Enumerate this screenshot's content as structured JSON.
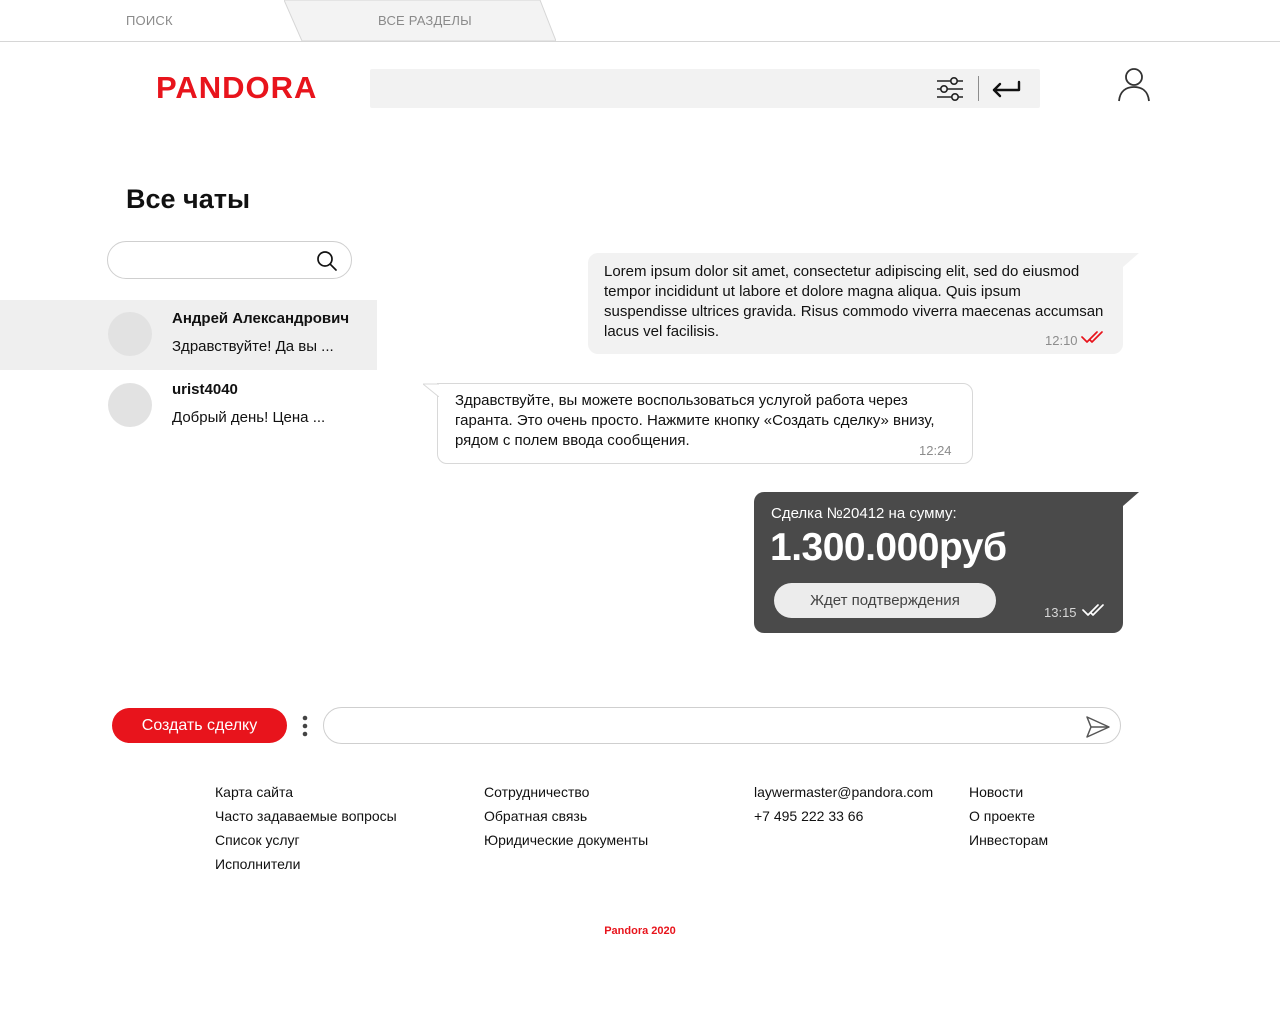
{
  "tabs": {
    "search": "ПОИСК",
    "all_sections": "ВСЕ РАЗДЕЛЫ"
  },
  "header": {
    "logo": "PANDORA",
    "search_value": ""
  },
  "sidebar": {
    "title": "Все чаты",
    "search_value": "",
    "chats": [
      {
        "name": "Андрей Александрович",
        "preview": "Здравствуйте! Да вы ...",
        "active": true
      },
      {
        "name": "urist4040",
        "preview": "Добрый день! Цена ...",
        "active": false
      }
    ]
  },
  "messages": {
    "out1": {
      "text": "Lorem ipsum dolor sit amet, consectetur adipiscing elit, sed do eiusmod tempor incididunt ut labore et dolore magna aliqua. Quis ipsum suspendisse ultrices gravida. Risus commodo viverra maecenas accumsan lacus vel facilisis.",
      "time": "12:10"
    },
    "in1": {
      "text": "Здравствуйте, вы можете воспользоваться услугой работа через гаранта. Это очень просто. Нажмите кнопку «Создать сделку» внизу, рядом с полем ввода сообщения.",
      "time": "12:24"
    },
    "deal": {
      "caption": "Сделка №20412 на сумму:",
      "amount": "1.300.000руб",
      "status": "Ждет подтверждения",
      "time": "13:15"
    }
  },
  "composer": {
    "create_deal": "Создать сделку",
    "value": ""
  },
  "footer": {
    "col1": [
      "Карта сайта",
      "Часто задаваемые вопросы",
      "Список услуг",
      "Исполнители"
    ],
    "col2": [
      "Сотрудничество",
      "Обратная связь",
      "Юридические документы"
    ],
    "col3": [
      "laywermaster@pandora.com",
      "+7 495 222 33 66"
    ],
    "col4": [
      "Новости",
      "О проекте",
      "Инвесторам"
    ],
    "copyright": "Pandora 2020"
  },
  "colors": {
    "brand": "#e8141c",
    "bubble_out": "#f2f2f2",
    "deal_card": "#4a4a4a",
    "read_check_red": "#e8141c"
  },
  "icons": [
    "filter-icon",
    "enter-icon",
    "user-icon",
    "search-icon",
    "double-check-icon",
    "more-vertical-icon",
    "send-icon"
  ]
}
